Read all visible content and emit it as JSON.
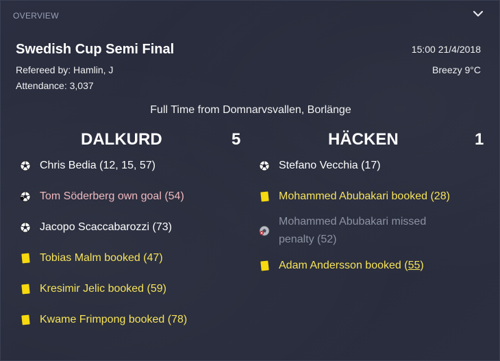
{
  "header": {
    "section_label": "OVERVIEW"
  },
  "match": {
    "competition": "Swedish Cup Semi Final",
    "referee": "Refereed by: Hamlin, J",
    "attendance": "Attendance: 3,037",
    "datetime": "15:00 21/4/2018",
    "weather": "Breezy 9°C",
    "venue_line": "Full Time from Domnarvsvallen, Borlänge"
  },
  "home": {
    "name": "DALKURD",
    "score": "5",
    "events": [
      {
        "type": "goal",
        "icon": "football-icon",
        "text": "Chris Bedia (12, 15, 57)"
      },
      {
        "type": "owngoal",
        "icon": "own-goal-icon",
        "text": "Tom Söderberg own goal (54)"
      },
      {
        "type": "goal",
        "icon": "football-icon",
        "text": "Jacopo Scaccabarozzi (73)"
      },
      {
        "type": "booked",
        "icon": "yellow-card-icon",
        "text": "Tobias Malm booked (47)"
      },
      {
        "type": "booked",
        "icon": "yellow-card-icon",
        "text": "Kresimir Jelic booked (59)"
      },
      {
        "type": "booked",
        "icon": "yellow-card-icon",
        "text": "Kwame Frimpong booked (78)"
      }
    ]
  },
  "away": {
    "name": "HÄCKEN",
    "score": "1",
    "events": [
      {
        "type": "goal",
        "icon": "football-icon",
        "text": "Stefano Vecchia (17)"
      },
      {
        "type": "booked",
        "icon": "yellow-card-icon",
        "text": "Mohammed Abubakari booked (28)"
      },
      {
        "type": "missed",
        "icon": "missed-penalty-icon",
        "text": "Mohammed Abubakari missed penalty (52)"
      },
      {
        "type": "booked",
        "icon": "yellow-card-icon",
        "text_main": "Adam Andersson booked (",
        "text_link": "55",
        "text_end": ")"
      }
    ]
  },
  "colors": {
    "booked_text": "#f6e35b",
    "own_goal_text": "#f0b8bf",
    "missed_text": "#8d92a3",
    "card_yellow": "#f6d90f"
  }
}
